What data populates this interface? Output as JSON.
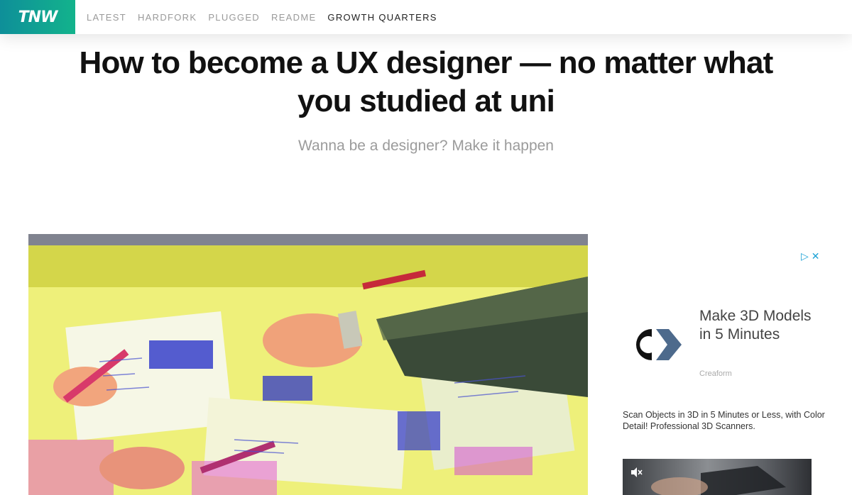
{
  "header": {
    "logo_text": "TNW",
    "nav": [
      {
        "label": "LATEST"
      },
      {
        "label": "HARDFORK"
      },
      {
        "label": "PLUGGED"
      },
      {
        "label": "README"
      },
      {
        "label": "GROWTH QUARTERS",
        "active": true
      }
    ],
    "brand_colors": {
      "logo_start": "#0e8f99",
      "logo_end": "#13b38c"
    }
  },
  "article": {
    "title": "How to become a UX designer — no matter what you studied at uni",
    "subtitle": "Wanna be a designer? Make it happen"
  },
  "ad": {
    "controls": {
      "adchoices_icon": "play-triangle-icon",
      "close_icon": "close-icon"
    },
    "headline": "Make 3D Models in 5 Minutes",
    "brand": "Creaform",
    "description": "Scan Objects in 3D in 5 Minutes or Less, with Color Detail! Professional 3D Scanners.",
    "video_icon": "mute-icon",
    "accent_color": "#1aa1d6"
  }
}
